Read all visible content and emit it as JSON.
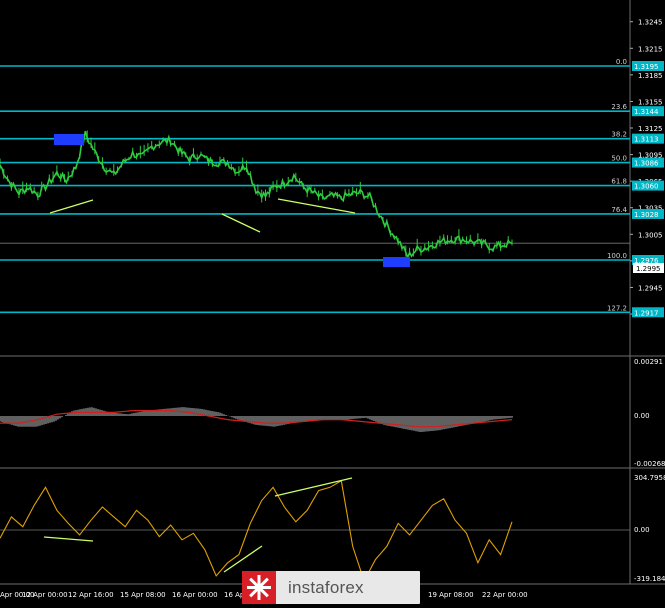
{
  "colors": {
    "background": "#000000",
    "level_line": "#00b7c7",
    "price": "#2ecc40",
    "divergence": "#ccff66",
    "macd_bar": "#bfbfbf",
    "signal": "#d02020",
    "cci": "#e0a000",
    "marker_box": "#1f3dff",
    "axis_text": "#ffffff",
    "panel_border": "#6e6e6e"
  },
  "price_axis": [
    "1.3245",
    "1.3215",
    "1.3185",
    "1.3155",
    "1.3125",
    "1.3095",
    "1.3065",
    "1.3035",
    "1.3005",
    "1.2975",
    "1.2945",
    "1.2915"
  ],
  "fib_levels": [
    {
      "label": "0.0",
      "price": "1.3195"
    },
    {
      "label": "23.6",
      "price": "1.3144"
    },
    {
      "label": "38.2",
      "price": "1.3113"
    },
    {
      "label": "50.0",
      "price": "1.3086"
    },
    {
      "label": "61.8",
      "price": "1.3060"
    },
    {
      "label": "76.4",
      "price": "1.3028"
    },
    {
      "label": "100.0",
      "price": "1.2976"
    },
    {
      "label": "127.2",
      "price": "1.2917"
    }
  ],
  "current_price": "1.2995",
  "macd_axis": [
    "0.00291",
    "0.00",
    "-0.00268"
  ],
  "cci_axis": [
    "304.7958",
    "0.00",
    "-319.1846"
  ],
  "time_axis": [
    "Apr 00:00",
    "12 Apr 00:00",
    "12 Apr 16:00",
    "15 Apr 08:00",
    "16 Apr 00:00",
    "16 Apr",
    "19 Apr 08:00",
    "22 Apr 00:00"
  ],
  "watermark": "instaforex",
  "chart_data": {
    "type": "line",
    "title": "",
    "xlabel": "",
    "ylabel": "",
    "ylim": [
      1.2905,
      1.3255
    ],
    "price_series": [
      1.3083,
      1.3064,
      1.3052,
      1.3058,
      1.305,
      1.3061,
      1.3074,
      1.3066,
      1.3081,
      1.3118,
      1.3098,
      1.3081,
      1.3072,
      1.3086,
      1.3096,
      1.3092,
      1.3104,
      1.3109,
      1.3111,
      1.3098,
      1.309,
      1.3095,
      1.3088,
      1.3086,
      1.3086,
      1.3076,
      1.3083,
      1.3055,
      1.3048,
      1.3059,
      1.3063,
      1.3071,
      1.3058,
      1.3052,
      1.3045,
      1.3048,
      1.3046,
      1.305,
      1.3052,
      1.3047,
      1.3028,
      1.3012,
      1.2998,
      1.298,
      1.2988,
      1.299,
      1.2995,
      1.2998,
      1.3,
      1.2999,
      1.2996,
      1.2994,
      1.299,
      1.2993,
      1.2995
    ],
    "macd_ylim": [
      -0.00268,
      0.00291
    ],
    "macd_histogram": [
      -0.0003,
      -0.0006,
      -0.0006,
      -0.0003,
      0.0003,
      0.0005,
      0.0002,
      0.0001,
      0.0003,
      0.0004,
      0.0005,
      0.0004,
      0.0002,
      -0.0002,
      -0.0005,
      -0.0006,
      -0.0004,
      -0.0003,
      -0.0002,
      -0.0002,
      -0.0001,
      -0.0005,
      -0.0007,
      -0.0009,
      -0.0008,
      -0.0006,
      -0.0004,
      -0.0002,
      -0.0001
    ],
    "macd_signal": [
      -0.0004,
      -0.0004,
      -0.0002,
      0.0001,
      0.0002,
      0.0002,
      0.0002,
      0.0003,
      0.0003,
      0.0003,
      0.0002,
      0.0,
      -0.0002,
      -0.0003,
      -0.0004,
      -0.0004,
      -0.0003,
      -0.0002,
      -0.0002,
      -0.0003,
      -0.0004,
      -0.0005,
      -0.0006,
      -0.0006,
      -0.0005,
      -0.0004,
      -0.0003,
      -0.0002
    ],
    "cci_ylim": [
      -319.1846,
      304.7958
    ],
    "cci": [
      -50,
      80,
      20,
      150,
      260,
      120,
      40,
      -30,
      60,
      140,
      80,
      20,
      120,
      60,
      -40,
      30,
      -60,
      -20,
      -120,
      -280,
      -200,
      -150,
      40,
      180,
      260,
      140,
      50,
      120,
      240,
      260,
      300,
      -100,
      -310,
      -180,
      -100,
      40,
      -30,
      60,
      150,
      190,
      60,
      -20,
      -200,
      -60,
      -150,
      50
    ]
  }
}
